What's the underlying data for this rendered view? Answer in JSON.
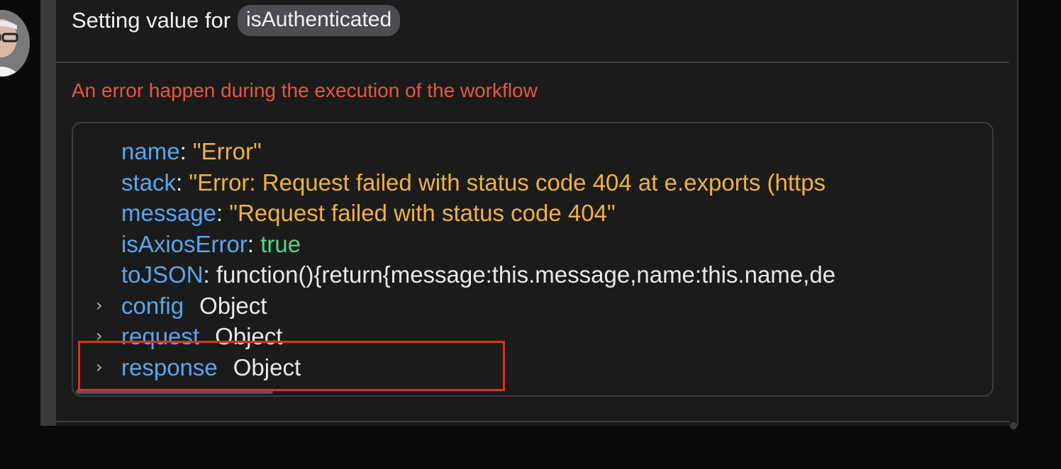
{
  "header": {
    "prefix": "Setting value for",
    "variable": "isAuthenticated"
  },
  "error": {
    "message": "An error happen during the execution of the workflow"
  },
  "object_view": {
    "name_key": "name",
    "name_value": "\"Error\"",
    "stack_key": "stack",
    "stack_value": "\"Error: Request failed with status code 404 at e.exports (https",
    "message_key": "message",
    "message_value": "\"Request failed with status code 404\"",
    "isAxiosError_key": "isAxiosError",
    "isAxiosError_value": "true",
    "toJSON_key": "toJSON",
    "toJSON_value": "function(){return{message:this.message,name:this.name,de",
    "config_key": "config",
    "config_type": "Object",
    "request_key": "request",
    "request_type": "Object",
    "response_key": "response",
    "response_type": "Object",
    "colon": ":",
    "expand_glyph": "›"
  },
  "colors": {
    "key": "#58a6f0",
    "string": "#f0b141",
    "boolean": "#55d48a",
    "error": "#e4583e",
    "highlight": "#e32d1d"
  }
}
